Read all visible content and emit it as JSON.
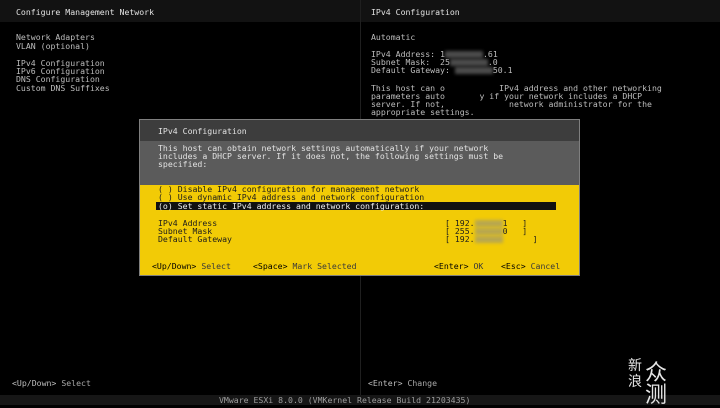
{
  "header": {
    "left_title": "Configure Management Network",
    "right_title": "IPv4 Configuration"
  },
  "menu": {
    "items": [
      "Network Adapters",
      "VLAN (optional)",
      "",
      "IPv4 Configuration",
      "IPv6 Configuration",
      "DNS Configuration",
      "Custom DNS Suffixes"
    ]
  },
  "right_panel": {
    "mode": "Automatic",
    "ipv4_address": {
      "label": "IPv4 Address:",
      "prefix": "1",
      "suffix": ".61"
    },
    "subnet_mask": {
      "label": "Subnet Mask:",
      "prefix": "25",
      "suffix": ".0"
    },
    "default_gateway": {
      "label": "Default Gateway:",
      "prefix": "",
      "suffix": "50.1"
    },
    "help_lines": [
      "This host can o           IPv4 address and other networking",
      "parameters auto       y if your network includes a DHCP",
      "server. If not,             network administrator for the",
      "appropriate settings."
    ]
  },
  "dialog": {
    "title": "IPv4 Configuration",
    "desc_lines": [
      "This host can obtain network settings automatically if your network",
      "includes a DHCP server. If it does not, the following settings must be",
      "specified:"
    ],
    "options": [
      "( ) Disable IPv4 configuration for management network",
      "( ) Use dynamic IPv4 address and network configuration",
      "(o) Set static IPv4 address and network configuration:"
    ],
    "fields": [
      {
        "label": "IPv4 Address",
        "open": "[ 192.",
        "close": "1   ]"
      },
      {
        "label": "Subnet Mask",
        "open": "[ 255.",
        "close": "0   ]"
      },
      {
        "label": "Default Gateway",
        "open": "[ 192.",
        "close": "]"
      }
    ],
    "hints": {
      "updown_key": "<Up/Down>",
      "updown_action": "Select",
      "space_key": "<Space>",
      "space_action": "Mark Selected",
      "enter_key": "<Enter>",
      "enter_action": "OK",
      "esc_key": "<Esc>",
      "esc_action": "Cancel"
    }
  },
  "status": {
    "left_key": "<Up/Down>",
    "left_action": "Select",
    "right_key": "<Enter>",
    "right_action": "Change",
    "footer": "VMware ESXi 8.0.0 (VMKernel Release Build 21203435)"
  },
  "watermark": {
    "line1": "新",
    "line2": "浪",
    "brand": "众测"
  }
}
